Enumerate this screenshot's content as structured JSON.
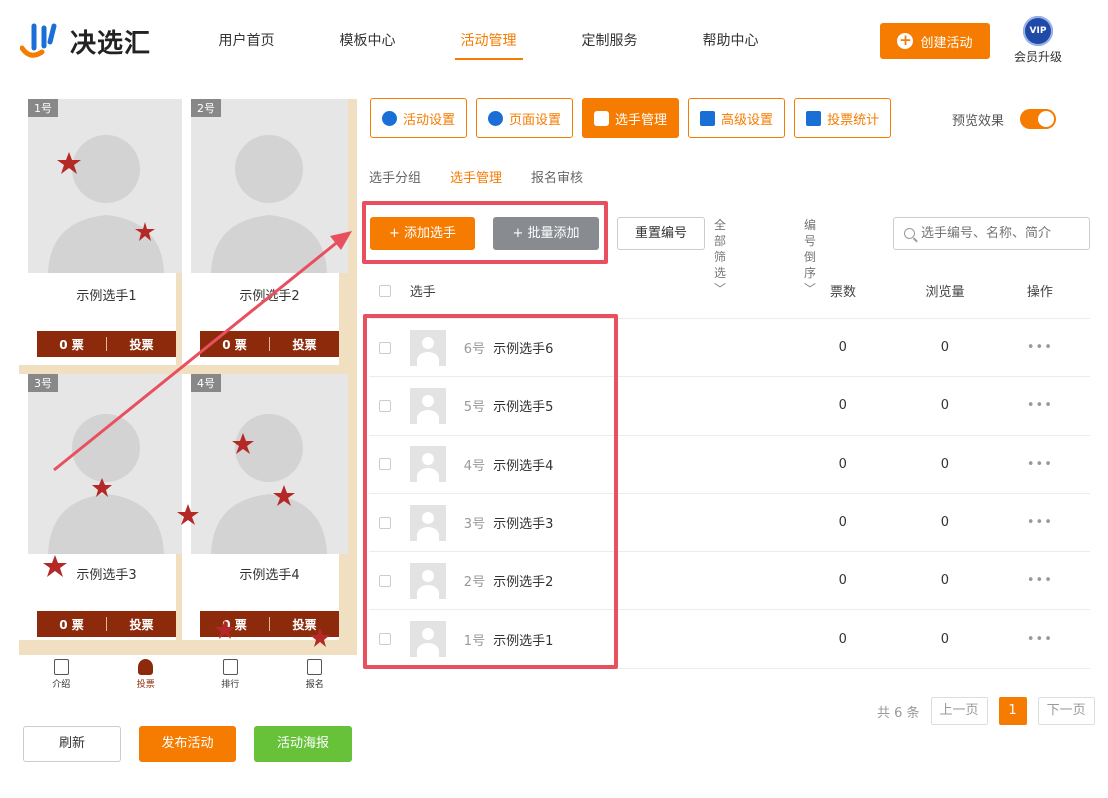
{
  "header": {
    "logo_text": "决选汇",
    "nav": [
      "用户首页",
      "模板中心",
      "活动管理",
      "定制服务",
      "帮助中心"
    ],
    "create_label": "创建活动",
    "vip_badge": "VIP",
    "vip_label": "会员升级"
  },
  "preview": {
    "cards": [
      {
        "tag": "1号",
        "name": "示例选手1",
        "votes": "0 票",
        "vote_label": "投票"
      },
      {
        "tag": "2号",
        "name": "示例选手2",
        "votes": "0 票",
        "vote_label": "投票"
      },
      {
        "tag": "3号",
        "name": "示例选手3",
        "votes": "0 票",
        "vote_label": "投票"
      },
      {
        "tag": "4号",
        "name": "示例选手4",
        "votes": "0 票",
        "vote_label": "投票"
      }
    ],
    "tabbar": [
      "介绍",
      "投票",
      "排行",
      "报名"
    ],
    "active_tab": "投票"
  },
  "bottom_buttons": {
    "refresh": "刷新",
    "publish": "发布活动",
    "poster": "活动海报"
  },
  "tooltabs": [
    "活动设置",
    "页面设置",
    "选手管理",
    "高级设置",
    "投票统计"
  ],
  "active_tooltab": "选手管理",
  "preview_toggle": {
    "label": "预览效果",
    "on": true
  },
  "subtabs": [
    "选手分组",
    "选手管理",
    "报名审核"
  ],
  "active_subtab": "选手管理",
  "actions": {
    "add": "+ 添加选手",
    "batch": "+ 批量添加",
    "reset": "重置编号",
    "filter": "全部筛选",
    "sort": "编号倒序",
    "search_placeholder": "选手编号、名称、简介"
  },
  "table": {
    "headers": {
      "player": "选手",
      "votes": "票数",
      "views": "浏览量",
      "ops": "操作"
    },
    "rows": [
      {
        "num": "6号",
        "name": "示例选手6",
        "votes": "0",
        "views": "0",
        "ops": "•••"
      },
      {
        "num": "5号",
        "name": "示例选手5",
        "votes": "0",
        "views": "0",
        "ops": "•••"
      },
      {
        "num": "4号",
        "name": "示例选手4",
        "votes": "0",
        "views": "0",
        "ops": "•••"
      },
      {
        "num": "3号",
        "name": "示例选手3",
        "votes": "0",
        "views": "0",
        "ops": "•••"
      },
      {
        "num": "2号",
        "name": "示例选手2",
        "votes": "0",
        "views": "0",
        "ops": "•••"
      },
      {
        "num": "1号",
        "name": "示例选手1",
        "votes": "0",
        "views": "0",
        "ops": "•••"
      }
    ]
  },
  "pager": {
    "total": "共 6 条",
    "prev": "上一页",
    "current": "1",
    "next": "下一页"
  },
  "colors": {
    "accent": "#f57c00",
    "highlight": "#e9505f",
    "vote_bar": "#8e2a0c",
    "green": "#67c23a"
  }
}
